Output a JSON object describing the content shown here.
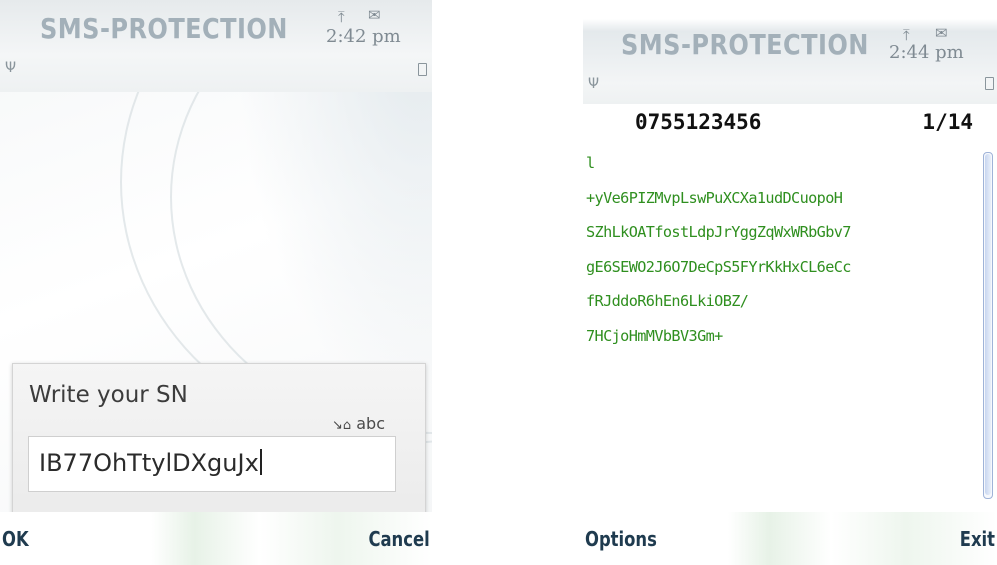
{
  "left_screen": {
    "app_title": "SMS-PROTECTION",
    "clock": "2:42 pm",
    "status_icons": {
      "upload": "⤒",
      "mail": "✉",
      "signal": "Ψ"
    },
    "dialog": {
      "prompt": "Write your SN",
      "mode_indicator": "abc",
      "mode_icon": "↘⌂",
      "input_value": "IB77OhTtylDXguJx"
    },
    "softkeys": {
      "left": "OK",
      "right": "Cancel"
    }
  },
  "right_screen": {
    "app_title": "SMS-PROTECTION",
    "clock": "2:44 pm",
    "status_icons": {
      "upload": "⤒",
      "mail": "✉",
      "signal": "Ψ"
    },
    "message": {
      "sender": "0755123456",
      "page": "1/14",
      "lines": [
        "l",
        "+yVe6PIZMvpLswPuXCXa1udDCuopoH",
        "SZhLkOATfostLdpJrYggZqWxWRbGbv7",
        "gE6SEWO2J6O7DeCpS5FYrKkHxCL6eCc",
        "fRJddoR6hEn6LkiOBZ/",
        "7HCjoHmMVbBV3Gm+"
      ]
    },
    "softkeys": {
      "left": "Options",
      "right": "Exit"
    }
  },
  "colors": {
    "title": "#a3b0b9",
    "message_text": "#2f8f1f",
    "softkey_text": "#1f3b4f",
    "accent_green": "#e7f2e7"
  }
}
